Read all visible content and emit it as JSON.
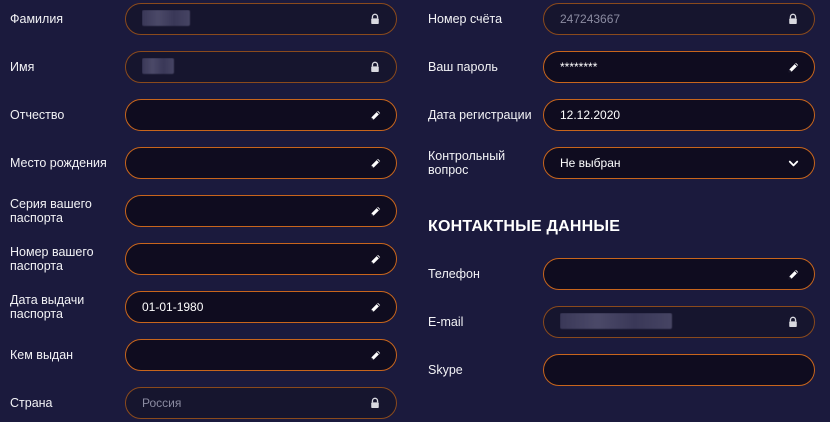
{
  "left": {
    "last_name": {
      "label": "Фамилия",
      "value": ""
    },
    "first_name": {
      "label": "Имя",
      "value": ""
    },
    "patronymic": {
      "label": "Отчество",
      "value": ""
    },
    "birth_place": {
      "label": "Место рождения",
      "value": ""
    },
    "passport_series": {
      "label": "Серия вашего\nпаспорта",
      "value": ""
    },
    "passport_number": {
      "label": "Номер вашего\nпаспорта",
      "value": ""
    },
    "passport_date": {
      "label": "Дата выдачи\nпаспорта",
      "value": "01-01-1980"
    },
    "issued_by": {
      "label": "Кем выдан",
      "value": ""
    },
    "country": {
      "label": "Страна",
      "value": "Россия"
    }
  },
  "right": {
    "account_number": {
      "label": "Номер счёта",
      "value": "247243667"
    },
    "password": {
      "label": "Ваш пароль",
      "value": "********"
    },
    "registration_date": {
      "label": "Дата регистрации",
      "value": "12.12.2020"
    },
    "security_question": {
      "label": "Контрольный\nвопрос",
      "value": "Не выбран"
    },
    "contacts_title": "КОНТАКТНЫЕ ДАННЫЕ",
    "phone": {
      "label": "Телефон",
      "value": ""
    },
    "email": {
      "label": "E-mail",
      "value": ""
    },
    "skype": {
      "label": "Skype",
      "value": ""
    }
  },
  "icons": {
    "lock": "lock-icon",
    "edit": "pencil-icon",
    "dropdown": "chevron-down-icon"
  },
  "colors": {
    "background": "#1b1a3d",
    "field_bg": "#0f0c1f",
    "field_border": "#c8651c",
    "text": "#ffffff",
    "muted": "#8b8ba1"
  }
}
